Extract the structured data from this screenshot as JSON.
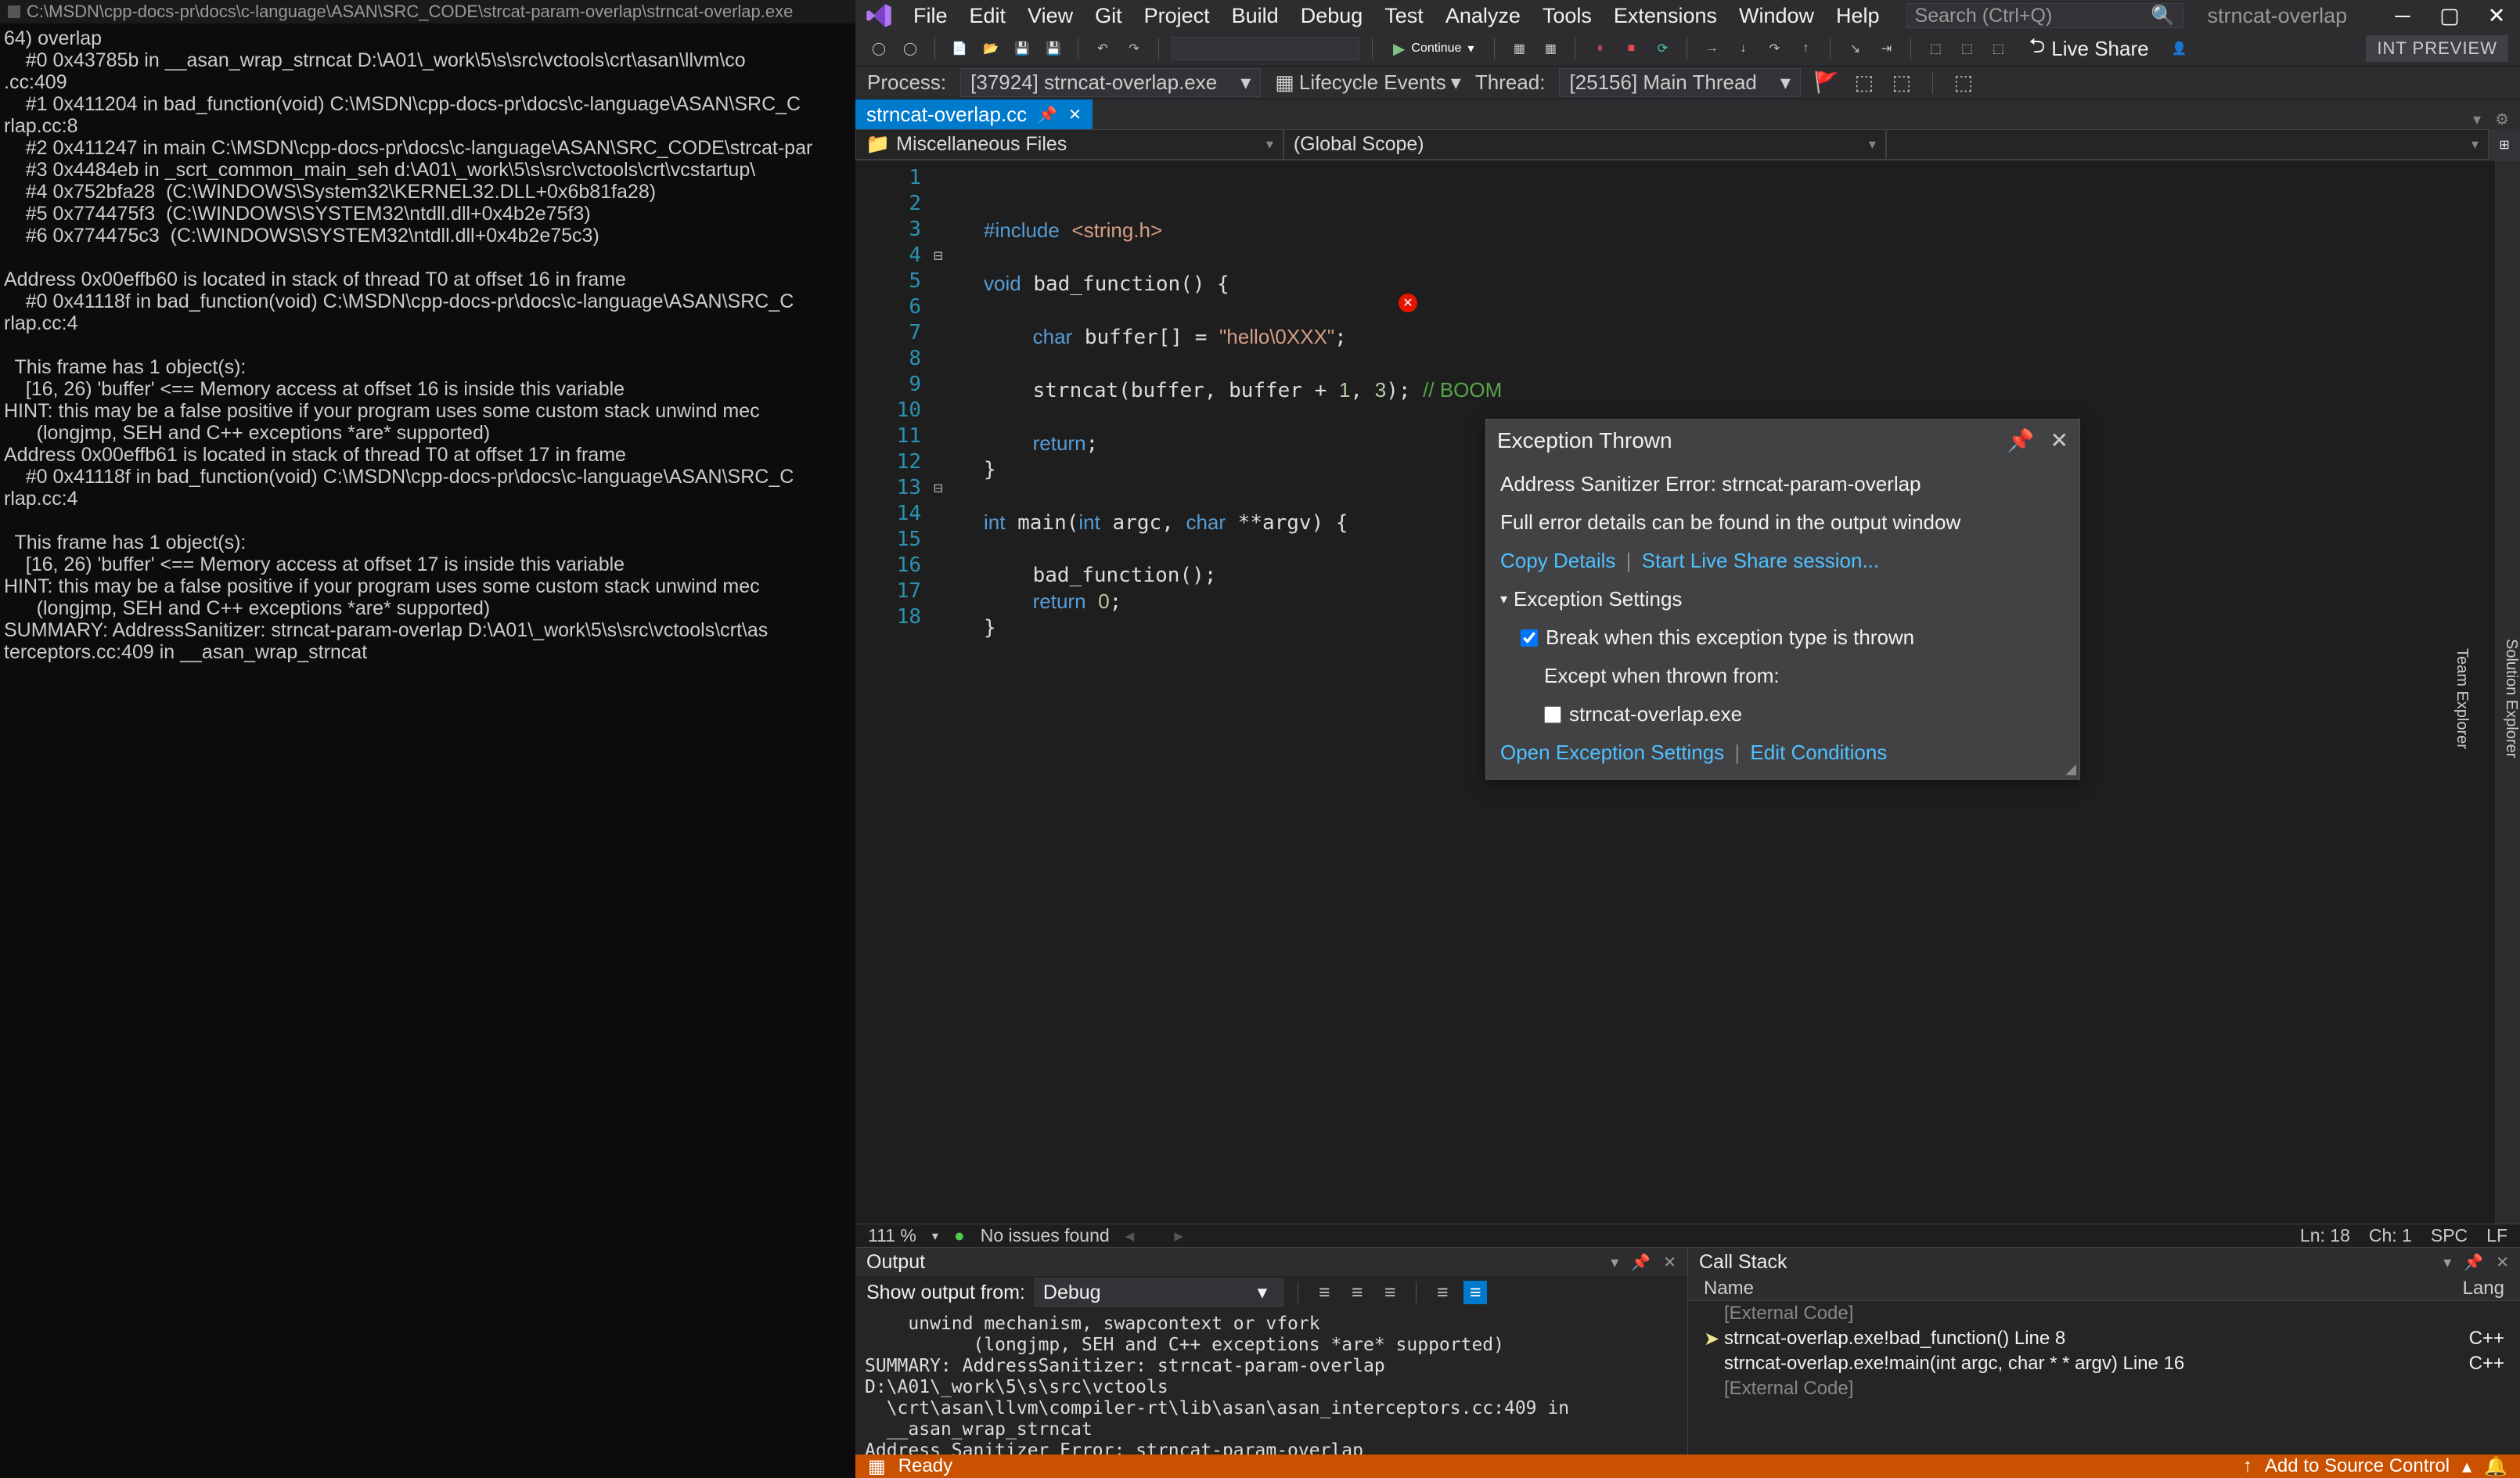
{
  "cmd": {
    "title": "C:\\MSDN\\cpp-docs-pr\\docs\\c-language\\ASAN\\SRC_CODE\\strcat-param-overlap\\strncat-overlap.exe",
    "body": "64) overlap\n    #0 0x43785b in __asan_wrap_strncat D:\\A01\\_work\\5\\s\\src\\vctools\\crt\\asan\\llvm\\co\n.cc:409\n    #1 0x411204 in bad_function(void) C:\\MSDN\\cpp-docs-pr\\docs\\c-language\\ASAN\\SRC_C\nrlap.cc:8\n    #2 0x411247 in main C:\\MSDN\\cpp-docs-pr\\docs\\c-language\\ASAN\\SRC_CODE\\strcat-par\n    #3 0x4484eb in _scrt_common_main_seh d:\\A01\\_work\\5\\s\\src\\vctools\\crt\\vcstartup\\\n    #4 0x752bfa28  (C:\\WINDOWS\\System32\\KERNEL32.DLL+0x6b81fa28)\n    #5 0x774475f3  (C:\\WINDOWS\\SYSTEM32\\ntdll.dll+0x4b2e75f3)\n    #6 0x774475c3  (C:\\WINDOWS\\SYSTEM32\\ntdll.dll+0x4b2e75c3)\n\nAddress 0x00effb60 is located in stack of thread T0 at offset 16 in frame\n    #0 0x41118f in bad_function(void) C:\\MSDN\\cpp-docs-pr\\docs\\c-language\\ASAN\\SRC_C\nrlap.cc:4\n\n  This frame has 1 object(s):\n    [16, 26) 'buffer' <== Memory access at offset 16 is inside this variable\nHINT: this may be a false positive if your program uses some custom stack unwind mec\n      (longjmp, SEH and C++ exceptions *are* supported)\nAddress 0x00effb61 is located in stack of thread T0 at offset 17 in frame\n    #0 0x41118f in bad_function(void) C:\\MSDN\\cpp-docs-pr\\docs\\c-language\\ASAN\\SRC_C\nrlap.cc:4\n\n  This frame has 1 object(s):\n    [16, 26) 'buffer' <== Memory access at offset 17 is inside this variable\nHINT: this may be a false positive if your program uses some custom stack unwind mec\n      (longjmp, SEH and C++ exceptions *are* supported)\nSUMMARY: AddressSanitizer: strncat-param-overlap D:\\A01\\_work\\5\\s\\src\\vctools\\crt\\as\nterceptors.cc:409 in __asan_wrap_strncat"
  },
  "vs": {
    "menu": [
      "File",
      "Edit",
      "View",
      "Git",
      "Project",
      "Build",
      "Debug",
      "Test",
      "Analyze",
      "Tools",
      "Extensions",
      "Window",
      "Help"
    ],
    "search_placeholder": "Search (Ctrl+Q)",
    "title": "strncat-overlap",
    "toolbar": {
      "continue_label": "Continue",
      "liveshare": "Live Share",
      "intpreview": "INT PREVIEW"
    },
    "debugbar": {
      "process_label": "Process:",
      "process_val": "[37924] strncat-overlap.exe",
      "lifecycle": "Lifecycle Events",
      "thread_label": "Thread:",
      "thread_val": "[25156] Main Thread"
    },
    "tab": {
      "name": "strncat-overlap.cc"
    },
    "scopes": {
      "left": "Miscellaneous Files",
      "mid": "(Global Scope)"
    },
    "side_expl": {
      "a": "Solution Explorer",
      "b": "Team Explorer"
    },
    "editor": {
      "linecount": 18,
      "zoom": "111 %",
      "issues": "No issues found",
      "ln": "Ln: 18",
      "ch": "Ch: 1",
      "spc": "SPC",
      "lf": "LF"
    },
    "exception": {
      "title": "Exception Thrown",
      "error": "Address Sanitizer Error: strncat-param-overlap",
      "details": "Full error details can be found in the output window",
      "copy": "Copy Details",
      "startshare": "Start Live Share session...",
      "settings": "Exception Settings",
      "break": "Break when this exception type is thrown",
      "except": "Except when thrown from:",
      "exe": "strncat-overlap.exe",
      "open": "Open Exception Settings",
      "edit": "Edit Conditions"
    },
    "output": {
      "title": "Output",
      "show_label": "Show output from:",
      "show_val": "Debug",
      "body": "    unwind mechanism, swapcontext or vfork\n          (longjmp, SEH and C++ exceptions *are* supported)\nSUMMARY: AddressSanitizer: strncat-param-overlap D:\\A01\\_work\\5\\s\\src\\vctools\n  \\crt\\asan\\llvm\\compiler-rt\\lib\\asan\\asan_interceptors.cc:409 in\n  __asan_wrap_strncat\nAddress Sanitizer Error: strncat-param-overlap"
    },
    "callstack": {
      "title": "Call Stack",
      "name_col": "Name",
      "lang_col": "Lang",
      "rows": [
        {
          "txt": "[External Code]",
          "dim": true,
          "lang": "",
          "ptr": false
        },
        {
          "txt": "strncat-overlap.exe!bad_function() Line 8",
          "dim": false,
          "lang": "C++",
          "ptr": true
        },
        {
          "txt": "strncat-overlap.exe!main(int argc, char * * argv) Line 16",
          "dim": false,
          "lang": "C++",
          "ptr": false
        },
        {
          "txt": "[External Code]",
          "dim": true,
          "lang": "",
          "ptr": false
        }
      ]
    },
    "statusbar": {
      "ready": "Ready",
      "source": "Add to Source Control"
    }
  }
}
